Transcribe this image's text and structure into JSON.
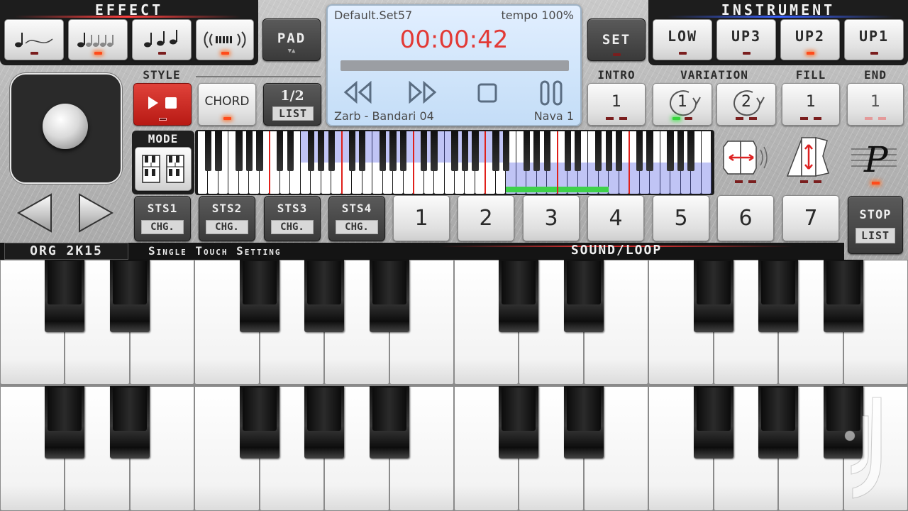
{
  "effect": {
    "title": "EFFECT",
    "buttons": [
      {
        "icon": "note-bend-icon",
        "led": false
      },
      {
        "icon": "note-sustain-icon",
        "led": true
      },
      {
        "icon": "note-staccato-icon",
        "led": false
      },
      {
        "icon": "vibrato-icon",
        "led": true
      }
    ]
  },
  "pad": {
    "label": "PAD"
  },
  "display": {
    "set_name": "Default.Set57",
    "tempo": "tempo 100%",
    "time": "00:00:42",
    "style_name": "Zarb - Bandari 04",
    "variation_name": "Nava 1"
  },
  "set_button": {
    "label": "SET"
  },
  "instrument": {
    "title": "INSTRUMENT",
    "buttons": [
      {
        "label": "LOW",
        "led": false
      },
      {
        "label": "UP3",
        "led": false
      },
      {
        "label": "UP2",
        "led": true
      },
      {
        "label": "UP1",
        "led": false
      }
    ]
  },
  "style": {
    "title": "STYLE",
    "chord_label": "CHORD",
    "list_top": "1/2",
    "list_bottom": "LIST"
  },
  "sections": {
    "intro": {
      "title": "INTRO",
      "value": "1"
    },
    "variation": {
      "title": "VARIATION",
      "values": [
        "1",
        "2"
      ]
    },
    "fill": {
      "title": "FILL",
      "value": "1"
    },
    "end": {
      "title": "END",
      "value": "1"
    }
  },
  "mode": {
    "title": "MODE"
  },
  "sts": [
    {
      "label": "STS1",
      "sub": "CHG."
    },
    {
      "label": "STS2",
      "sub": "CHG."
    },
    {
      "label": "STS3",
      "sub": "CHG."
    },
    {
      "label": "STS4",
      "sub": "CHG."
    }
  ],
  "pads": [
    "1",
    "2",
    "3",
    "4",
    "5",
    "6",
    "7"
  ],
  "stop": {
    "label": "STOP",
    "sub": "LIST"
  },
  "brand": "ORG 2K15",
  "sts_caption": "Single Touch Setting",
  "sound_caption": "SOUND/LOOP",
  "colors": {
    "accent_red": "#e0201a",
    "led_on": "#ff4a1a",
    "led_green": "#35d43b",
    "display_bg": "#d7e9fb",
    "time_color": "#e23a36"
  }
}
